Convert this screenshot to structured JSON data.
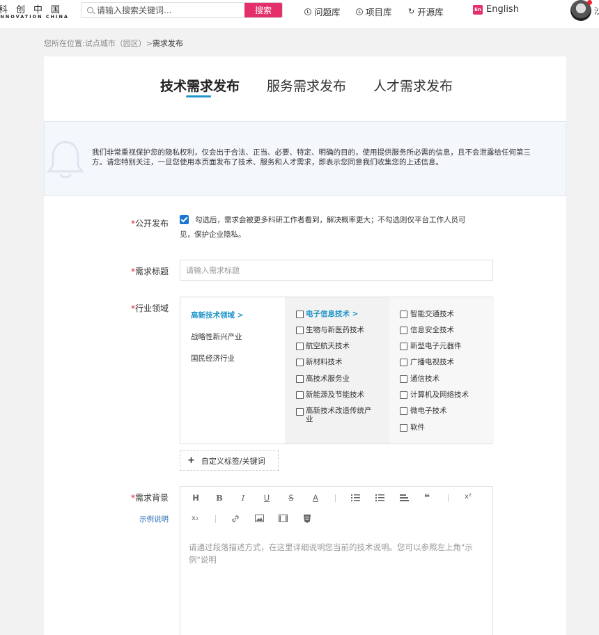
{
  "header": {
    "logo_cn": "科创中国",
    "logo_en": "INNOVATION CHINA",
    "search_placeholder": "请输入搜索关键词...",
    "search_button": "搜索",
    "nav": [
      "问题库",
      "项目库",
      "开源库"
    ],
    "lang_icon": "En",
    "lang": "English",
    "cut_text": "沙"
  },
  "breadcrumb": {
    "prefix": "您所在位置:试点城市（园区）>",
    "current": "需求发布"
  },
  "tabs": [
    "技术需求发布",
    "服务需求发布",
    "人才需求发布"
  ],
  "notice": "我们非常重视保护您的隐私权利，仅会出于合法、正当、必要、特定、明确的目的，使用提供服务所必需的信息，且不会泄露给任何第三方。请您特别关注，一旦您使用本页面发布了技术、服务和人才需求，即表示您同意我们收集您的上述信息。",
  "form": {
    "public_label": "公开发布",
    "public_desc": "勾选后，需求会被更多科研工作者看到，解决概率更大；不勾选则仅平台工作人员可见，保护企业隐私。",
    "title_label": "需求标题",
    "title_placeholder": "请输入需求标题",
    "industry_label": "行业领域",
    "industry": {
      "level1": [
        "高新技术领域 >",
        "战略性新兴产业",
        "国民经济行业"
      ],
      "level2": [
        "电子信息技术 >",
        "生物与新医药技术",
        "航空航天技术",
        "新材料技术",
        "高技术服务业",
        "新能源及节能技术",
        "高新技术改造传统产业"
      ],
      "level3": [
        "智能交通技术",
        "信息安全技术",
        "新型电子元器件",
        "广播电视技术",
        "通信技术",
        "计算机及网络技术",
        "微电子技术",
        "软件"
      ]
    },
    "custom_tag": "自定义标签/关键词",
    "background_label": "需求背景",
    "example_link": "示例说明",
    "editor_placeholder": "请通过段落描述方式，在这里详细说明您当前的技术说明。您可以参照左上角\"示例\"说明",
    "toolbar": [
      "H",
      "B",
      "I",
      "U",
      "S",
      "A",
      "ordered-list-icon",
      "bullet-list-icon",
      "align-icon",
      "quote-icon",
      "x²",
      "x₂",
      "link-icon",
      "image-icon",
      "video-icon",
      "html5-icon"
    ]
  }
}
